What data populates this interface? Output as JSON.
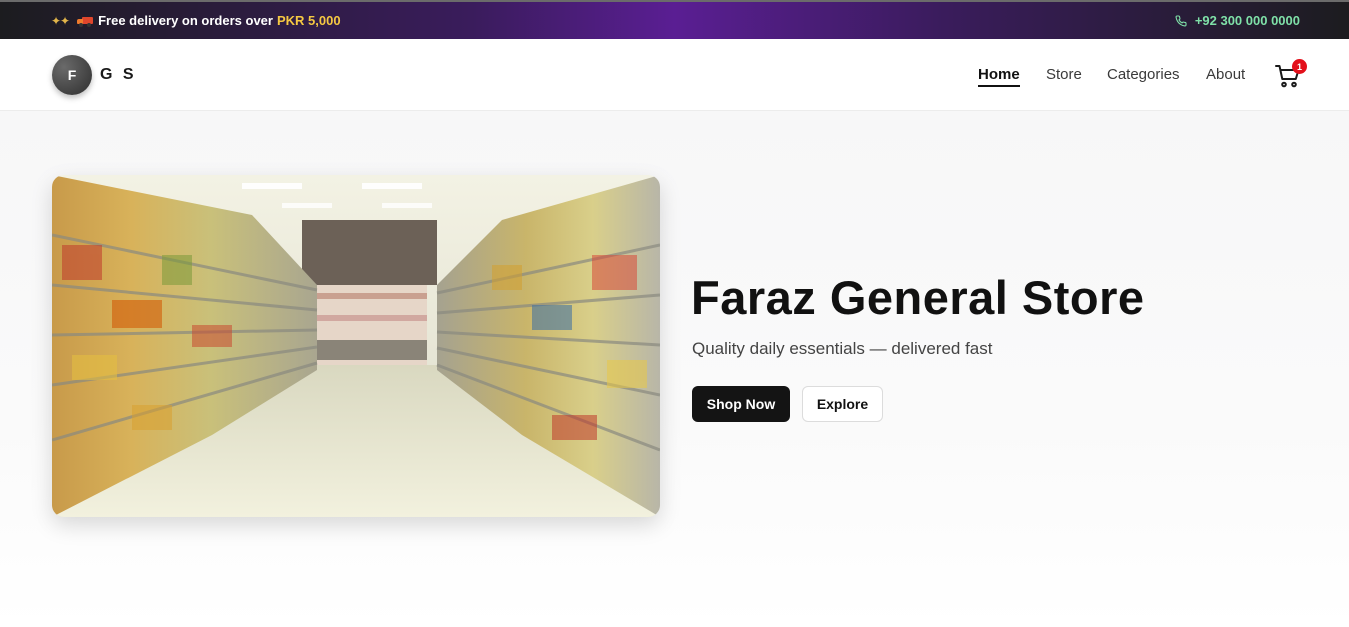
{
  "topbar": {
    "promo_text": "Free delivery on orders over",
    "promo_accent": "PKR 5,000",
    "phone": "+92 300 000 0000"
  },
  "brand": {
    "logo_letter": "F",
    "name": "G S"
  },
  "nav": {
    "items": [
      "Home",
      "Store",
      "Categories",
      "About"
    ],
    "active": "Home"
  },
  "cart": {
    "count": "1"
  },
  "hero": {
    "title": "Faraz General Store",
    "subtitle": "Quality daily essentials — delivered fast",
    "primary_button": "Shop Now",
    "secondary_button": "Explore"
  },
  "colors": {
    "accent_gold": "#f5c842",
    "phone_green": "#7fe0a8",
    "badge_red": "#e3101b",
    "primary_button": "#141414"
  },
  "icons": {
    "promo": [
      "sparkle-icon",
      "truck-icon"
    ],
    "phone": "phone-icon",
    "cart": "cart-icon"
  }
}
